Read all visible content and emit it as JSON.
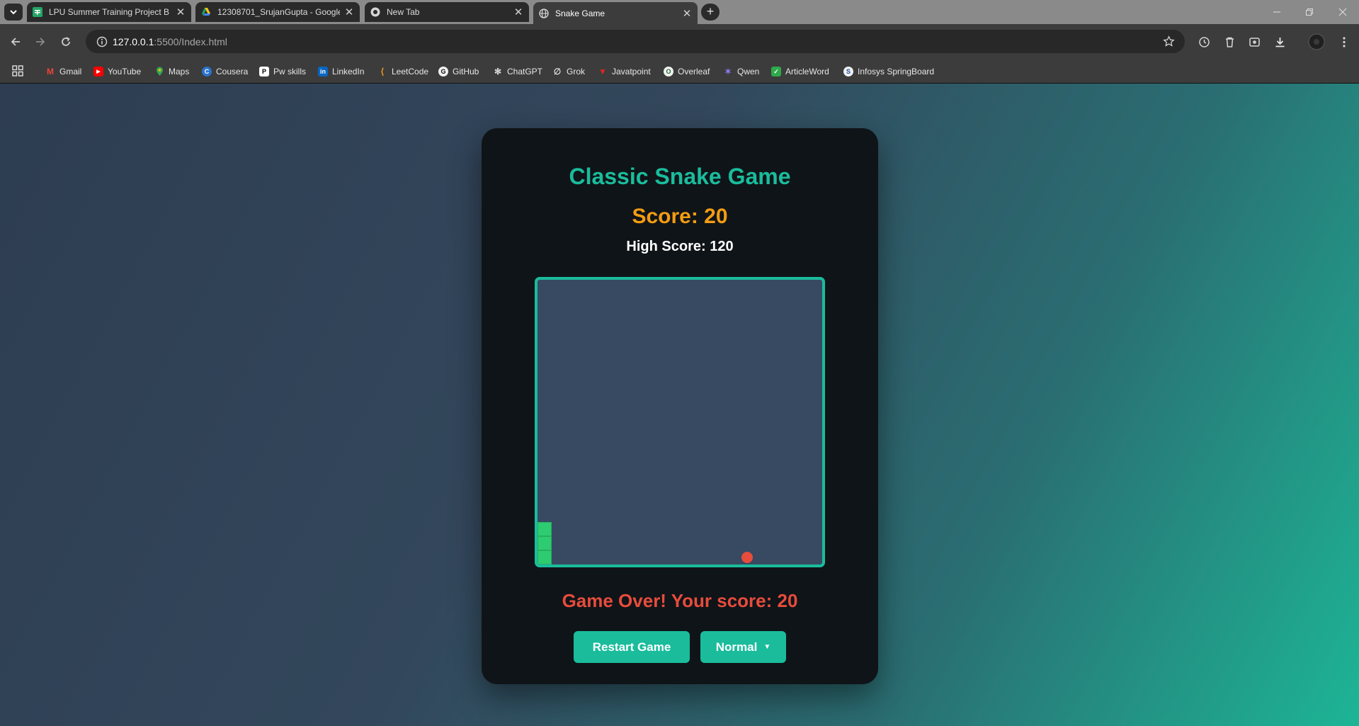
{
  "browser": {
    "tabs": [
      {
        "title": "LPU Summer Training Project B",
        "active": false,
        "favicon": "sheets-icon"
      },
      {
        "title": "12308701_SrujanGupta - Google",
        "active": false,
        "favicon": "drive-icon"
      },
      {
        "title": "New Tab",
        "active": false,
        "favicon": "chrome-icon"
      },
      {
        "title": "Snake Game",
        "active": true,
        "favicon": "globe-icon"
      }
    ],
    "url_host": "127.0.0.1",
    "url_rest": ":5500/Index.html",
    "bookmarks": [
      "Gmail",
      "YouTube",
      "Maps",
      "Cousera",
      "Pw skills",
      "LinkedIn",
      "LeetCode",
      "GitHub",
      "ChatGPT",
      "Grok",
      "Javatpoint",
      "Overleaf",
      "Qwen",
      "ArticleWord",
      "Infosys SpringBoard"
    ]
  },
  "game": {
    "title": "Classic Snake Game",
    "score": "Score: 20",
    "high_score": "High Score: 120",
    "status": "Game Over! Your score: 20",
    "restart_label": "Restart Game",
    "difficulty": "Normal"
  },
  "colors": {
    "accent": "#1abc9c",
    "score": "#f39c12",
    "danger": "#e74c3c",
    "snake": "#2ecc71",
    "board": "#374a62"
  }
}
